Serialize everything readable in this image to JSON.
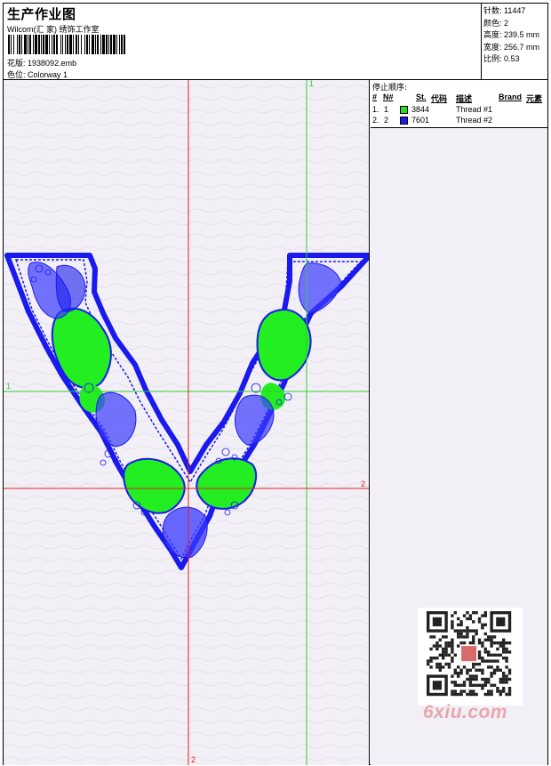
{
  "header": {
    "title": "生产作业图",
    "company": "Wilcom(汇 家) 绣饰工作室",
    "design_label": "花版:",
    "design_value": "1938092.emb",
    "colorway_label": "色位:",
    "colorway_value": "Colorway 1"
  },
  "specs": [
    {
      "label": "针数:",
      "value": "11447"
    },
    {
      "label": "颜色:",
      "value": "2"
    },
    {
      "label": "高度:",
      "value": "239.5 mm"
    },
    {
      "label": "宽度:",
      "value": "256.7 mm"
    },
    {
      "label": "比例:",
      "value": "0.53"
    }
  ],
  "guides": {
    "vertical_green_top": "1",
    "horizontal_green_left": "1",
    "horizontal_red_right": "2",
    "vertical_red_bottom": "2"
  },
  "stop_sequence": {
    "title": "停止顺序:",
    "columns": [
      "#",
      "N#",
      "St.",
      "代码",
      "描述",
      "Brand",
      "元素"
    ],
    "rows": [
      {
        "index": "1.",
        "needle": "1",
        "code": "3844",
        "description": "Thread #1",
        "color": "#22dd22"
      },
      {
        "index": "2.",
        "needle": "2",
        "code": "7601",
        "description": "Thread #2",
        "color": "#1a1aee"
      }
    ]
  },
  "colors": {
    "green_thread": "#22ee22",
    "blue_thread": "#1a1aee",
    "guide_green": "#33cc33",
    "guide_red": "#dd2222",
    "canvas_bg": "#f2f0f6"
  },
  "watermark": {
    "site": "6xiu.com",
    "qr_center": "汉绣图库"
  }
}
